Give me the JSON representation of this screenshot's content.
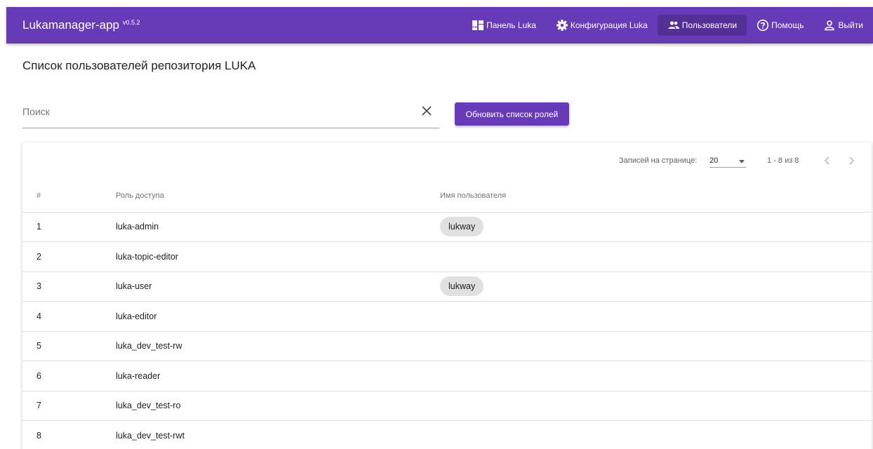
{
  "app": {
    "title": "Lukamanager-app",
    "version": "v0.5.2"
  },
  "nav": {
    "items": [
      {
        "label": "Панель Luka",
        "icon": "dashboard-icon",
        "active": false
      },
      {
        "label": "Конфигурация Luka",
        "icon": "gear-icon",
        "active": false
      },
      {
        "label": "Пользователи",
        "icon": "users-icon",
        "active": true
      },
      {
        "label": "Помощь",
        "icon": "help-circle-icon",
        "active": false
      },
      {
        "label": "Выйти",
        "icon": "user-logout-icon",
        "active": false
      }
    ]
  },
  "page": {
    "title": "Список пользователей репозитория LUKA"
  },
  "search": {
    "placeholder": "Поиск",
    "value": ""
  },
  "actions": {
    "refresh_label": "Обновить список ролей"
  },
  "paginator": {
    "page_size_label": "Записей на странице:",
    "page_size": "20",
    "range_label": "1 - 8 из 8"
  },
  "table": {
    "columns": [
      "#",
      "Роль доступа",
      "Имя пользователя"
    ],
    "rows": [
      {
        "num": "1",
        "role": "luka-admin",
        "users": [
          "lukway"
        ]
      },
      {
        "num": "2",
        "role": "luka-topic-editor",
        "users": []
      },
      {
        "num": "3",
        "role": "luka-user",
        "users": [
          "lukway"
        ]
      },
      {
        "num": "4",
        "role": "luka-editor",
        "users": []
      },
      {
        "num": "5",
        "role": "luka_dev_test-rw",
        "users": []
      },
      {
        "num": "6",
        "role": "luka-reader",
        "users": []
      },
      {
        "num": "7",
        "role": "luka_dev_test-ro",
        "users": []
      },
      {
        "num": "8",
        "role": "luka_dev_test-rwt",
        "users": []
      }
    ]
  },
  "colors": {
    "primary": "#673ab7",
    "chip": "#e0e0e0"
  }
}
